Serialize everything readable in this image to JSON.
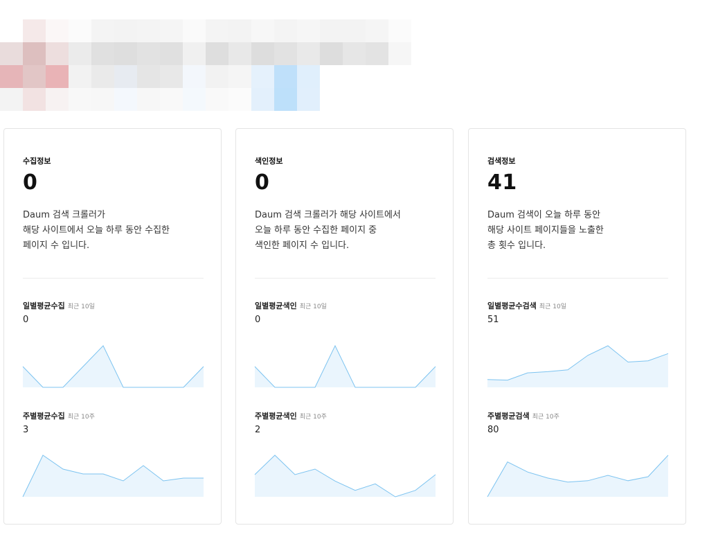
{
  "banner_colors": [
    [
      "#ffffff",
      "#f5e9e9",
      "#fbf7f7",
      "#fbfbfb",
      "#f4f4f4",
      "#f3f3f3",
      "#f4f4f4",
      "#f5f5f5",
      "#fafafa",
      "#f4f4f4",
      "#f3f3f3",
      "#f7f7f7",
      "#f4f4f4",
      "#f6f6f6",
      "#f3f3f3",
      "#f3f3f3",
      "#f5f5f5",
      "#fbfbfb"
    ],
    [
      "#e9dcdc",
      "#ddbfbf",
      "#eddede",
      "#ebebeb",
      "#e0e0e0",
      "#dedede",
      "#e2e2e2",
      "#e0e0e0",
      "#f0f0f0",
      "#dedede",
      "#e8e8e8",
      "#dddddd",
      "#e2e2e2",
      "#e9e9e9",
      "#dddddd",
      "#e6e6e6",
      "#e3e3e3",
      "#f6f6f6"
    ],
    [
      "#e6b5b8",
      "#e2c6c6",
      "#e9b3b6",
      "#f2f2f2",
      "#eaeaea",
      "#e7ebf1",
      "#e5e5e5",
      "#e8e8e8",
      "#f3f7fc",
      "#f2f2f2",
      "#f5f5f5",
      "#e5f1fc",
      "#bfe0fa",
      "#e0effc",
      "#ffffff",
      "#ffffff",
      "#ffffff",
      "#ffffff"
    ],
    [
      "#f3f3f3",
      "#f2e2e2",
      "#f7f2f2",
      "#f8f8f8",
      "#f7f7f7",
      "#f4f8fd",
      "#f7f7f7",
      "#f9f9f9",
      "#f4f9fd",
      "#f9f9f9",
      "#fbfbfb",
      "#e3f0fc",
      "#bde0fa",
      "#e1effc",
      "#ffffff",
      "#ffffff",
      "#ffffff",
      "#ffffff"
    ]
  ],
  "colors": {
    "spark_line": "#7cc3f0",
    "spark_fill": "#eaf5fd",
    "card_border": "#e4e4e4"
  },
  "cards": [
    {
      "title": "수집정보",
      "value": "0",
      "desc": [
        "Daum 검색 크롤러가",
        "해당 사이트에서 오늘 하루 동안 수집한",
        "페이지 수 입니다."
      ],
      "daily": {
        "label": "일별평균수집",
        "period": "최근 10일",
        "value": "0",
        "series": [
          1,
          0,
          0,
          1,
          2,
          0,
          0,
          0,
          0,
          1
        ]
      },
      "weekly": {
        "label": "주별평균수집",
        "period": "최근 10주",
        "value": "3",
        "series": [
          0,
          6,
          4,
          3.3,
          3.3,
          2.3,
          4.5,
          2.3,
          2.7,
          2.7
        ]
      }
    },
    {
      "title": "색인정보",
      "value": "0",
      "desc": [
        "Daum 검색 크롤러가 해당 사이트에서",
        "오늘 하루 동안 수집한 페이지 중",
        "색인한 페이지 수 입니다."
      ],
      "daily": {
        "label": "일별평균색인",
        "period": "최근 10일",
        "value": "0",
        "series": [
          1,
          0,
          0,
          0,
          2,
          0,
          0,
          0,
          0,
          1
        ]
      },
      "weekly": {
        "label": "주별평균색인",
        "period": "최근 10주",
        "value": "2",
        "series": [
          2.4,
          4.5,
          2.4,
          3.0,
          1.7,
          0.7,
          1.4,
          0,
          0.7,
          2.4
        ]
      }
    },
    {
      "title": "검색정보",
      "value": "41",
      "desc": [
        "Daum 검색이 오늘 하루 동안",
        "해당 사이트 페이지들을 노출한",
        "총 횟수 입니다."
      ],
      "daily": {
        "label": "일별평균수검색",
        "period": "최근 10일",
        "value": "51",
        "series": [
          1.3,
          1.2,
          2.4,
          2.6,
          2.9,
          5.3,
          6.9,
          4.2,
          4.4,
          5.6
        ]
      },
      "weekly": {
        "label": "주별평균검색",
        "period": "최근 10주",
        "value": "80",
        "series": [
          0,
          5.2,
          3.7,
          2.8,
          2.2,
          2.4,
          3.2,
          2.4,
          3.0,
          6.2
        ]
      }
    }
  ]
}
